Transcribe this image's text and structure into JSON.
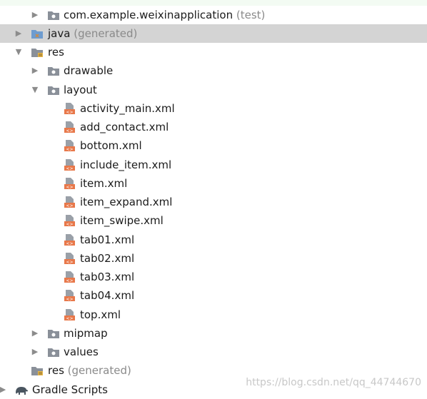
{
  "tree": {
    "top_package": {
      "label": "com.example.weixinapplication",
      "suffix": "(test)"
    },
    "java": {
      "label": "java",
      "suffix": "(generated)"
    },
    "res": {
      "label": "res"
    },
    "drawable": {
      "label": "drawable"
    },
    "layout": {
      "label": "layout"
    },
    "files": [
      "activity_main.xml",
      "add_contact.xml",
      "bottom.xml",
      "include_item.xml",
      "item.xml",
      "item_expand.xml",
      "item_swipe.xml",
      "tab01.xml",
      "tab02.xml",
      "tab03.xml",
      "tab04.xml",
      "top.xml"
    ],
    "mipmap": {
      "label": "mipmap"
    },
    "values": {
      "label": "values"
    },
    "res_generated": {
      "label": "res",
      "suffix": "(generated)"
    },
    "gradle": {
      "label": "Gradle Scripts"
    }
  },
  "watermark": "https://blog.csdn.net/qq_44744670",
  "colors": {
    "selected_row": "#d4d4d4",
    "folder": "#8a9099",
    "xml_badge": "#e8784a"
  }
}
